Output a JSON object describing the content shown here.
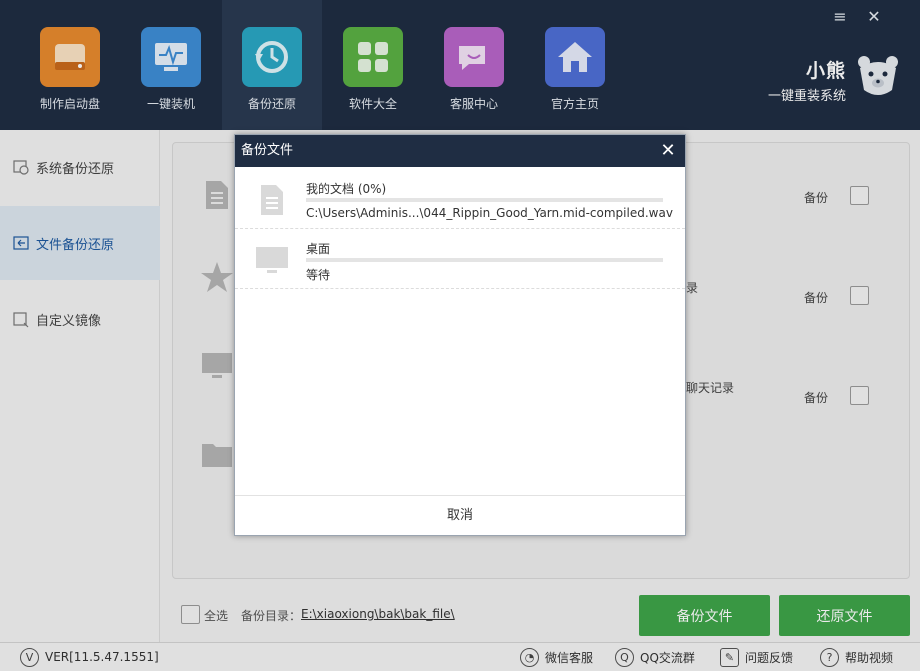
{
  "window": {
    "controls": {
      "menu": "≡",
      "close": "✕"
    }
  },
  "nav": {
    "items": [
      {
        "label": "制作启动盘",
        "icon": "usb-drive-icon",
        "color": "#e88a2e"
      },
      {
        "label": "一键装机",
        "icon": "monitor-pulse-icon",
        "color": "#3e8ed6"
      },
      {
        "label": "备份还原",
        "icon": "restore-icon",
        "color": "#2aa7c4",
        "active": true
      },
      {
        "label": "软件大全",
        "icon": "grid-icon",
        "color": "#5bb044"
      },
      {
        "label": "客服中心",
        "icon": "chat-icon",
        "color": "#b865c9"
      },
      {
        "label": "官方主页",
        "icon": "home-icon",
        "color": "#4f6fd6"
      }
    ]
  },
  "brand": {
    "line1": "小熊",
    "line2": "一键重装系统"
  },
  "sidebar": {
    "items": [
      {
        "label": "系统备份还原",
        "icon": "system-backup-icon"
      },
      {
        "label": "文件备份还原",
        "icon": "file-backup-icon",
        "active": true
      },
      {
        "label": "自定义镜像",
        "icon": "custom-image-icon"
      }
    ]
  },
  "main": {
    "rows": [
      {
        "icon": "document-icon",
        "action": "备份",
        "suffix": ""
      },
      {
        "icon": "star-icon",
        "action": "备份",
        "suffix": "录"
      },
      {
        "icon": "monitor-icon",
        "action": "备份",
        "suffix": "聊天记录"
      },
      {
        "icon": "folder-icon",
        "action": "",
        "suffix": ""
      }
    ]
  },
  "bottom": {
    "select_all": "全选",
    "dir_label": "备份目录：",
    "dir_path": "E:\\xiaoxiong\\bak\\bak_file\\",
    "backup_button": "备份文件",
    "restore_button": "还原文件"
  },
  "status": {
    "version": "VER[11.5.47.1551]",
    "wechat": "微信客服",
    "qq": "QQ交流群",
    "feedback": "问题反馈",
    "help": "帮助视频"
  },
  "dialog": {
    "title": "备份文件",
    "close": "✕",
    "tasks": [
      {
        "name": "我的文档 (0%)",
        "detail": "C:\\Users\\Adminis...\\044_Rippin_Good_Yarn.mid-compiled.wav",
        "icon": "document-icon",
        "progress": 0
      },
      {
        "name": "桌面",
        "detail": "等待",
        "icon": "desktop-icon",
        "progress": 0
      }
    ],
    "cancel": "取消"
  }
}
